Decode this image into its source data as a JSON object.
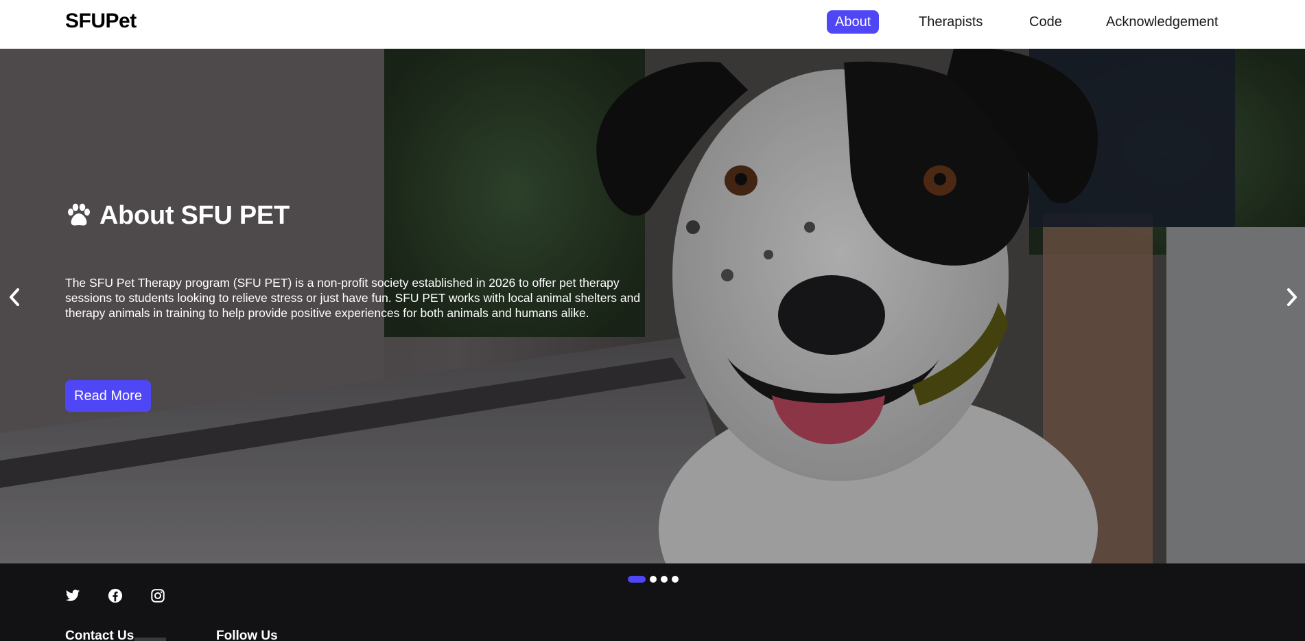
{
  "navbar": {
    "brand": "SFUPet",
    "items": [
      {
        "label": "About",
        "active": true
      },
      {
        "label": "Therapists",
        "active": false
      },
      {
        "label": "Code",
        "active": false
      },
      {
        "label": "Acknowledgement",
        "active": false
      }
    ]
  },
  "hero": {
    "title": "About SFU PET",
    "title_icon": "paw-icon",
    "description": "The SFU Pet Therapy program (SFU PET) is a non-profit society established in 2026 to offer pet therapy sessions to students looking to relieve stress or just have fun. SFU PET works with local animal shelters and therapy animals in training to help provide positive experiences for both animals and humans alike.",
    "button_label": "Read More",
    "prev_icon": "chevron-left-icon",
    "next_icon": "chevron-right-icon"
  },
  "carousel": {
    "slide_count": 4,
    "active_index": 0
  },
  "footer": {
    "social_icons": [
      "twitter-icon",
      "facebook-icon",
      "instagram-icon"
    ],
    "contact_title": "Contact Us",
    "follow_title": "Follow Us"
  },
  "colors": {
    "accent": "#4f46f5",
    "navbar_bg": "#ffffff",
    "footer_bg": "#121214"
  }
}
